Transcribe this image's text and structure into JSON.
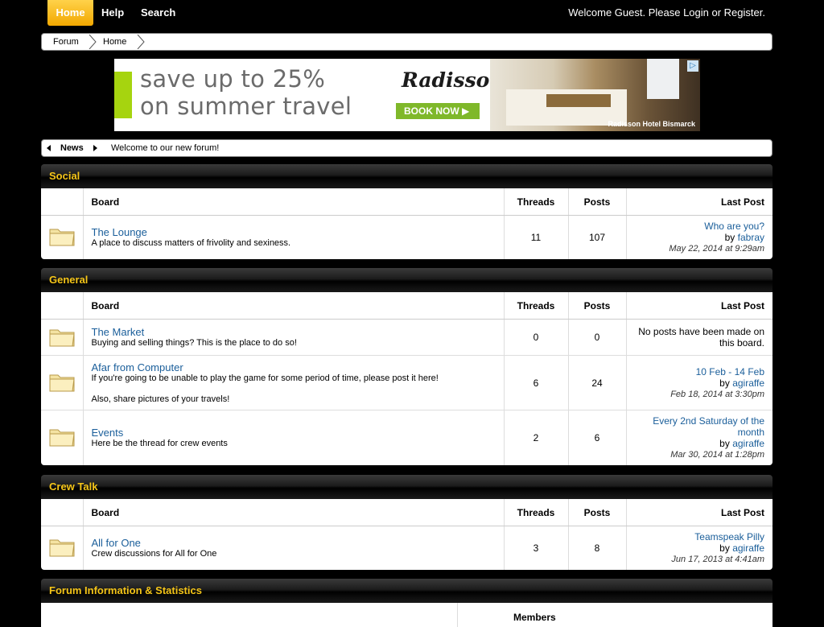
{
  "nav": {
    "home": "Home",
    "help": "Help",
    "search": "Search",
    "welcome_prefix": "Welcome Guest. Please ",
    "login": "Login",
    "welcome_or": " or ",
    "register": "Register",
    "welcome_suffix": "."
  },
  "breadcrumb": [
    "Forum",
    "Home"
  ],
  "ad": {
    "line1": "save up to 25%",
    "line2": "on summer travel",
    "brand": "Radisson",
    "cta": "BOOK NOW ▶",
    "caption": "Radisson Hotel Bismarck",
    "choices_icon": "adchoices-icon"
  },
  "news": {
    "label": "News",
    "text": "Welcome to our new forum!"
  },
  "columns": {
    "board": "Board",
    "threads": "Threads",
    "posts": "Posts",
    "last_post": "Last Post"
  },
  "categories": [
    {
      "name": "Social",
      "boards": [
        {
          "title": "The Lounge",
          "desc": "A place to discuss matters of frivolity and sexiness.",
          "threads": "11",
          "posts": "107",
          "last_title": "Who are you?",
          "last_by_prefix": "by ",
          "last_by": "fabray",
          "last_date": "May 22, 2014 at 9:29am"
        }
      ]
    },
    {
      "name": "General",
      "boards": [
        {
          "title": "The Market",
          "desc": "Buying and selling things? This is the place to do so!",
          "threads": "0",
          "posts": "0",
          "last_none": "No posts have been made on this board."
        },
        {
          "title": "Afar from Computer",
          "desc": "If you're going to be unable to play the game for some period of time, please post it here!\n\nAlso, share pictures of your travels!",
          "threads": "6",
          "posts": "24",
          "last_title": "10 Feb - 14 Feb",
          "last_by_prefix": "by ",
          "last_by": "agiraffe",
          "last_date": "Feb 18, 2014 at 3:30pm"
        },
        {
          "title": "Events",
          "desc": "Here be the thread for crew events",
          "threads": "2",
          "posts": "6",
          "last_title": "Every 2nd Saturday of the month",
          "last_by_prefix": "by ",
          "last_by": "agiraffe",
          "last_date": "Mar 30, 2014 at 1:28pm"
        }
      ]
    },
    {
      "name": "Crew Talk",
      "boards": [
        {
          "title": "All for One",
          "desc": "Crew discussions for All for One",
          "threads": "3",
          "posts": "8",
          "last_title": "Teamspeak Pilly",
          "last_by_prefix": "by ",
          "last_by": "agiraffe",
          "last_date": "Jun 17, 2013 at 4:41am"
        }
      ]
    }
  ],
  "info": {
    "title": "Forum Information & Statistics",
    "members": "Members"
  },
  "colors": {
    "accent": "#f5c518",
    "link": "#1a5e9a",
    "background": "#000000"
  }
}
